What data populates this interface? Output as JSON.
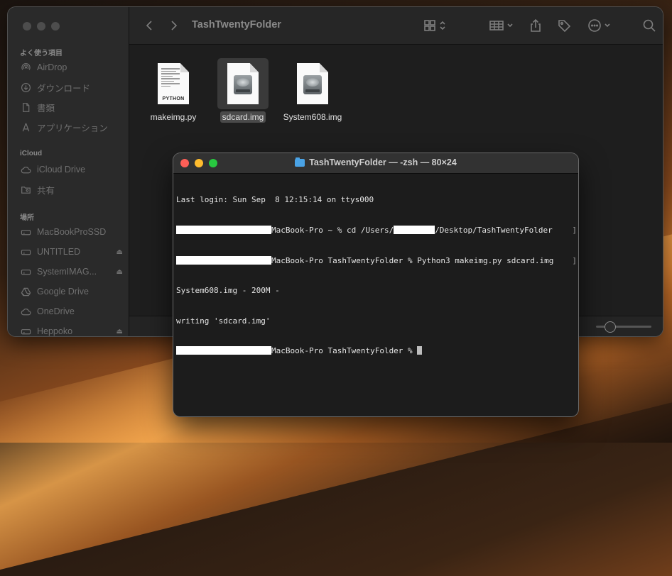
{
  "finder": {
    "title": "TashTwentyFolder",
    "sidebar": {
      "favorites_header": "よく使う項目",
      "favorites": [
        {
          "label": "AirDrop",
          "icon": "airdrop-icon"
        },
        {
          "label": "ダウンロード",
          "icon": "download-icon"
        },
        {
          "label": "書類",
          "icon": "document-icon"
        },
        {
          "label": "アプリケーション",
          "icon": "applications-icon"
        }
      ],
      "icloud_header": "iCloud",
      "icloud": [
        {
          "label": "iCloud Drive",
          "icon": "cloud-icon"
        },
        {
          "label": "共有",
          "icon": "shared-folder-icon"
        }
      ],
      "locations_header": "場所",
      "locations": [
        {
          "label": "MacBookProSSD",
          "icon": "disk-icon",
          "eject": false
        },
        {
          "label": "UNTITLED",
          "icon": "disk-icon",
          "eject": true
        },
        {
          "label": "SystemIMAG...",
          "icon": "disk-icon",
          "eject": true
        },
        {
          "label": "Google Drive",
          "icon": "google-drive-icon",
          "eject": false
        },
        {
          "label": "OneDrive",
          "icon": "cloud-icon",
          "eject": false
        },
        {
          "label": "Heppoko",
          "icon": "disk-icon",
          "eject": true
        }
      ]
    },
    "files": [
      {
        "name": "makeimg.py",
        "kind": "python",
        "tag": "PYTHON",
        "selected": false
      },
      {
        "name": "sdcard.img",
        "kind": "disk-image",
        "selected": true
      },
      {
        "name": "System608.img",
        "kind": "disk-image",
        "selected": false
      }
    ]
  },
  "terminal": {
    "title": "TashTwentyFolder — -zsh — 80×24",
    "lines": {
      "l1": "Last login: Sun Sep  8 12:15:14 on ttys000",
      "l2a": "MacBook-Pro ~ % cd /Users/",
      "l2b": "/Desktop/TashTwentyFolder",
      "l3": "MacBook-Pro TashTwentyFolder % Python3 makeimg.py sdcard.img",
      "l4": "System608.img - 200M -",
      "l5": "writing 'sdcard.img'",
      "l6": "MacBook-Pro TashTwentyFolder % "
    }
  }
}
